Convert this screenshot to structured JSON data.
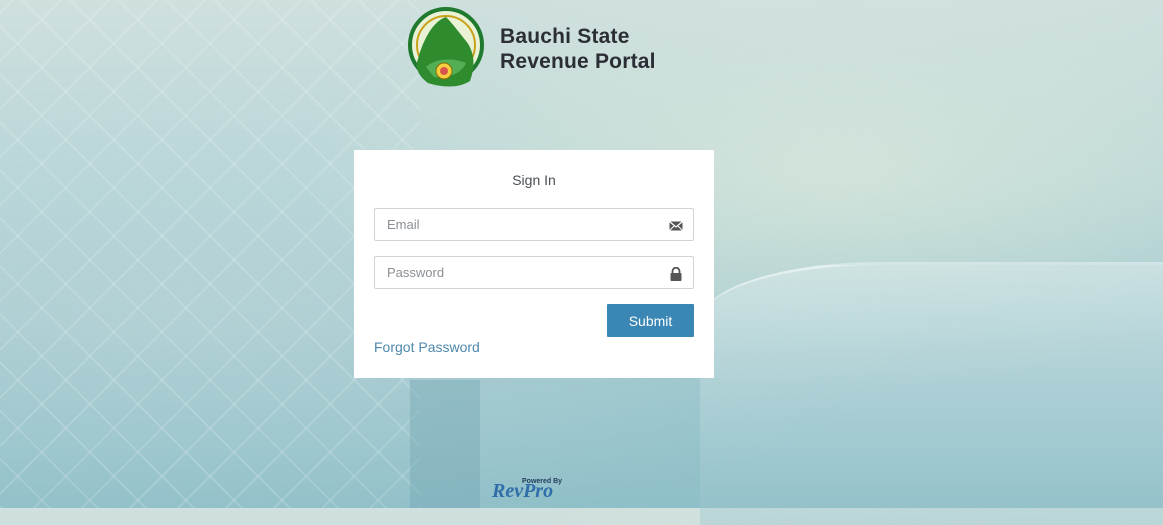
{
  "brand": {
    "line1": "Bauchi State",
    "line2": "Revenue Portal",
    "seal_icon": "bauchi-state-seal"
  },
  "signin": {
    "title": "Sign In",
    "email_placeholder": "Email",
    "email_icon": "envelope-icon",
    "password_placeholder": "Password",
    "password_icon": "lock-icon",
    "submit_label": "Submit",
    "forgot_label": "Forgot Password"
  },
  "footer": {
    "powered_by": "Powered By",
    "vendor": "RevPro"
  },
  "colors": {
    "accent": "#3a86b4",
    "link": "#4d88ad",
    "seal_green": "#2e8b2e"
  }
}
